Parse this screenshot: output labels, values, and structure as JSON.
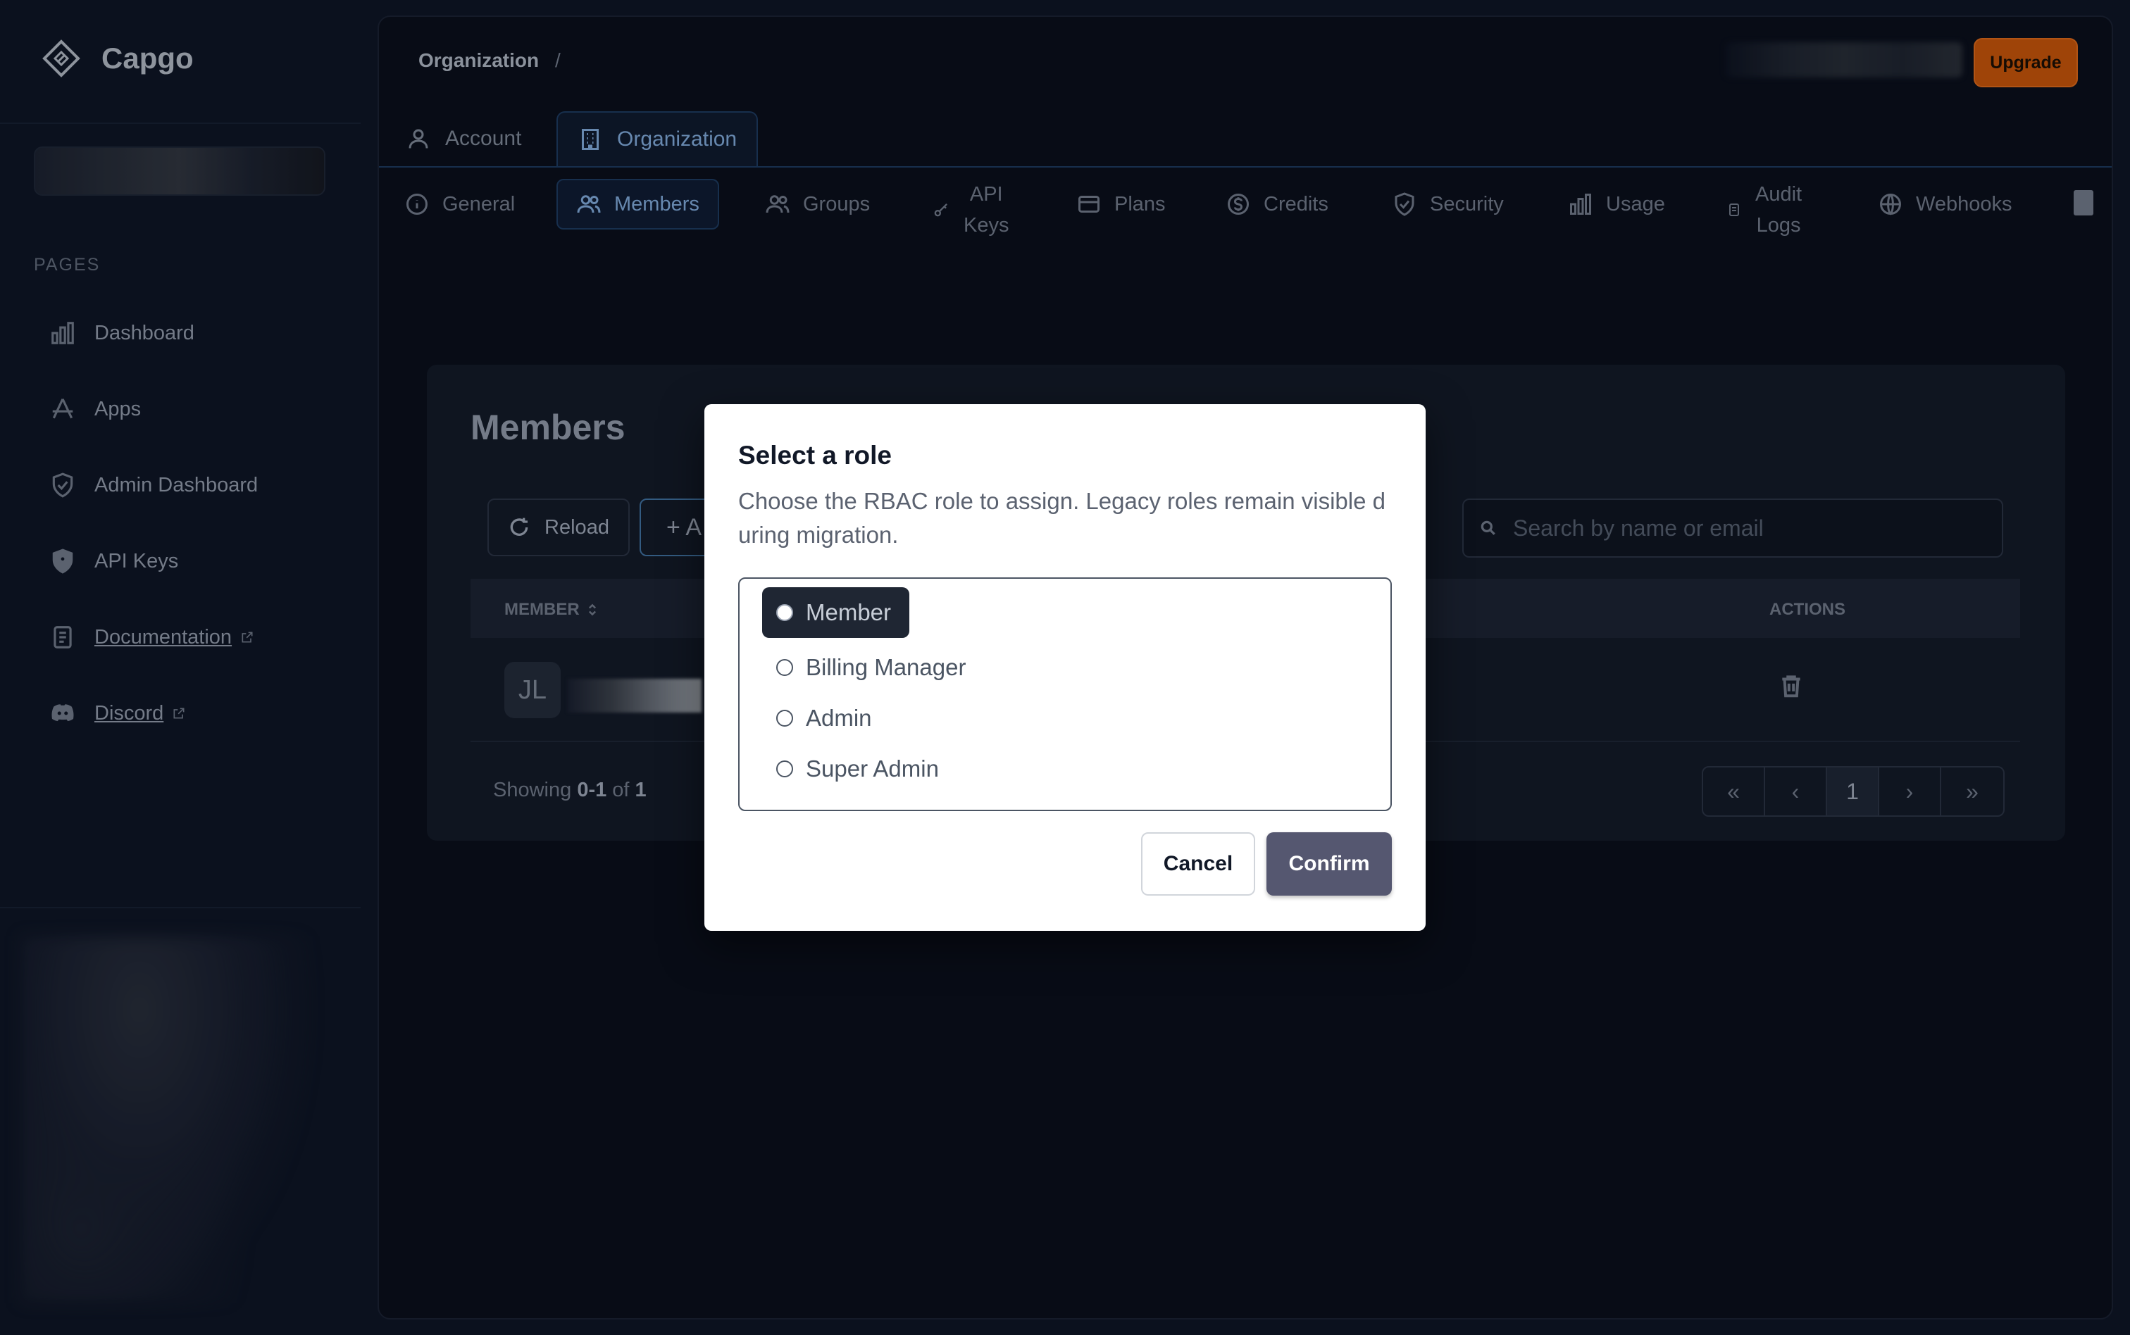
{
  "app": {
    "name": "Capgo"
  },
  "sidebar": {
    "section_label": "PAGES",
    "items": [
      {
        "label": "Dashboard",
        "icon": "bar-chart-icon"
      },
      {
        "label": "Apps",
        "icon": "apps-icon"
      },
      {
        "label": "Admin Dashboard",
        "icon": "shield-check-icon"
      },
      {
        "label": "API Keys",
        "icon": "shield-key-icon"
      },
      {
        "label": "Documentation",
        "icon": "document-icon",
        "external": true
      },
      {
        "label": "Discord",
        "icon": "discord-icon",
        "external": true
      }
    ]
  },
  "header": {
    "breadcrumb": "Organization",
    "breadcrumb_sep": "/",
    "upgrade_label": "Upgrade",
    "upgrade_color": "#c2540a"
  },
  "tabs": [
    {
      "label": "Account",
      "icon": "user-icon",
      "active": false
    },
    {
      "label": "Organization",
      "icon": "building-icon",
      "active": true
    }
  ],
  "subtabs": [
    {
      "label": "General",
      "icon": "info-icon"
    },
    {
      "label": "Members",
      "icon": "users-icon",
      "active": true
    },
    {
      "label": "Groups",
      "icon": "groups-icon"
    },
    {
      "label_line1": "API",
      "label_line2": "Keys",
      "icon": "key-icon"
    },
    {
      "label": "Plans",
      "icon": "credit-card-icon"
    },
    {
      "label": "Credits",
      "icon": "dollar-icon"
    },
    {
      "label": "Security",
      "icon": "shield-icon"
    },
    {
      "label": "Usage",
      "icon": "bar-chart-icon"
    },
    {
      "label_line1": "Audit",
      "label_line2": "Logs",
      "icon": "audit-icon"
    },
    {
      "label": "Webhooks",
      "icon": "globe-icon"
    }
  ],
  "members": {
    "title": "Members",
    "reload_label": "Reload",
    "add_label": "+  A",
    "search_placeholder": "Search by name or email",
    "columns": {
      "member": "MEMBER",
      "actions": "ACTIONS"
    },
    "rows": [
      {
        "initials": "JL"
      }
    ],
    "showing_prefix": "Showing",
    "showing_range": "0-1",
    "showing_of": "of",
    "showing_total": "1",
    "pager": {
      "first": "«",
      "prev": "‹",
      "current": "1",
      "next": "›",
      "last": "»"
    }
  },
  "modal": {
    "title": "Select a role",
    "description": "Choose the RBAC role to assign. Legacy roles remain visible during migration.",
    "roles": [
      {
        "label": "Member",
        "selected": true
      },
      {
        "label": "Billing Manager",
        "selected": false
      },
      {
        "label": "Admin",
        "selected": false
      },
      {
        "label": "Super Admin",
        "selected": false
      }
    ],
    "cancel_label": "Cancel",
    "confirm_label": "Confirm"
  }
}
